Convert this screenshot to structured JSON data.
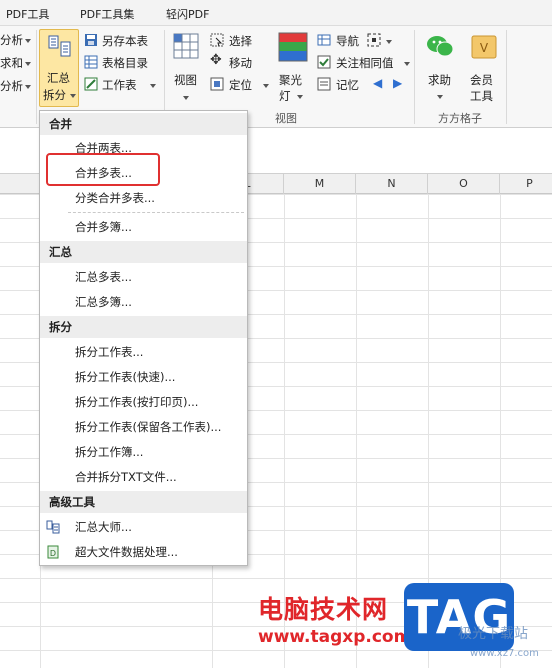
{
  "tabs": [
    "PDF工具",
    "PDF工具集",
    "轻闪PDF"
  ],
  "ribbon": {
    "left_partial": [
      "分析",
      "求和",
      "分析"
    ],
    "merge_split_button": [
      "汇总",
      "拆分"
    ],
    "save_as_book": "另存本表",
    "sheet_catalog": "表格目录",
    "worksheet": "工作表",
    "view": "视图",
    "select": "选择",
    "move": "移动",
    "locate": "定位",
    "spotlight": [
      "聚光",
      "灯"
    ],
    "navigate": "导航",
    "follow_same_value": "关注相同值",
    "memo": "记忆",
    "help": "求助",
    "member_tools": [
      "会员",
      "工具"
    ],
    "group_view": "视图",
    "group_fangfang": "方方格子"
  },
  "columns": [
    "L",
    "M",
    "N",
    "O",
    "P"
  ],
  "menu": {
    "sections": [
      {
        "title": "合并",
        "items": [
          "合并两表...",
          "合并多表...",
          "分类合并多表...",
          "合并多簿..."
        ]
      },
      {
        "title": "汇总",
        "items": [
          "汇总多表...",
          "汇总多簿..."
        ]
      },
      {
        "title": "拆分",
        "items": [
          "拆分工作表...",
          "拆分工作表(快速)...",
          "拆分工作表(按打印页)...",
          "拆分工作表(保留各工作表)...",
          "拆分工作簿...",
          "合并拆分TXT文件..."
        ]
      },
      {
        "title": "高级工具",
        "items": [
          "汇总大师...",
          "超大文件数据处理..."
        ]
      }
    ],
    "highlighted": "合并多表..."
  },
  "watermark": {
    "site_name": "电脑技术网",
    "site_url": "www.tagxp.com",
    "logo": "TAG",
    "corner_text": "极光下载站",
    "corner_url": "www.xz7.com"
  },
  "colors": {
    "highlight_border": "#e03030",
    "active_button": "#fde7a3",
    "tag_blue": "#1a64c9",
    "watermark_red": "#e0262a"
  }
}
